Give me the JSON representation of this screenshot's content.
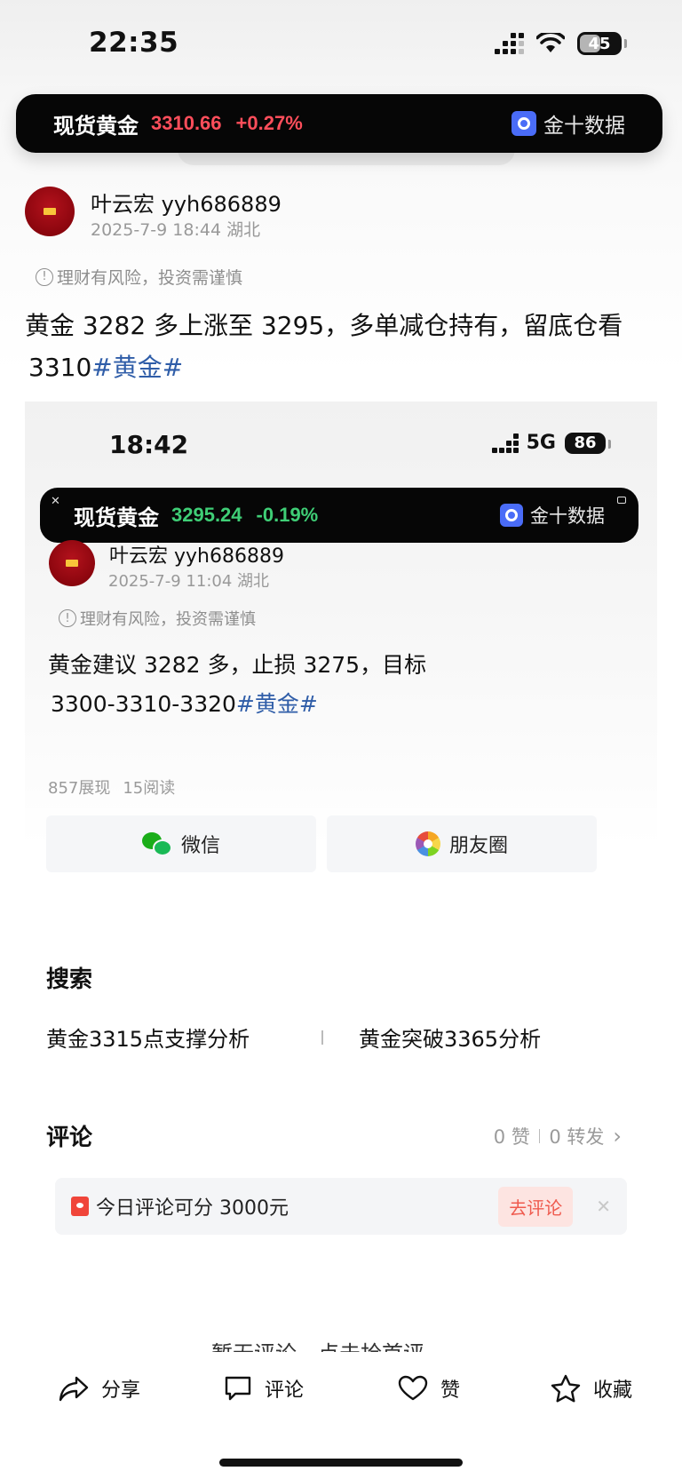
{
  "status_bar": {
    "time": "22:35",
    "battery": "45"
  },
  "ticker": {
    "name": "现货黄金",
    "price": "3310.66",
    "change": "+0.27%",
    "brand": "金十数据",
    "color": "#ff4e5b"
  },
  "post": {
    "author": "叶云宏 yyh686889",
    "meta": "2025-7-9 18:44   湖北",
    "risk_note": "理财有风险，投资需谨慎",
    "text_line1": "黄金 3282 多上涨至 3295，多单减仓持有，留底仓看",
    "text_line2": "3310",
    "hashtag": "#黄金#"
  },
  "embedded_screenshot": {
    "time": "18:42",
    "network": "5G",
    "battery": "86",
    "ticker": {
      "name": "现货黄金",
      "price": "3295.24",
      "change": "-0.19%",
      "brand": "金十数据",
      "color": "#3fce76"
    },
    "author": "叶云宏 yyh686889",
    "meta": "2025-7-9 11:04   湖北",
    "risk_note": "理财有风险，投资需谨慎",
    "text_line1": "黄金建议 3282 多，止损 3275，目标",
    "text_line2": "3300-3310-3320",
    "hashtag": "#黄金#",
    "views": "857展现",
    "reads": "15阅读",
    "share_wechat": "微信",
    "share_moments": "朋友圈",
    "search_title": "搜索",
    "search_items": [
      "黄金3315点支撑分析",
      "黄金突破3365分析"
    ],
    "comments_title": "评论",
    "likes": "0 赞",
    "reposts": "0 转发",
    "promo_text": "今日评论可分 3000元",
    "promo_button": "去评论",
    "cut_off_text": "暂无评论，点击抢首评"
  },
  "bottom_bar": {
    "share": "分享",
    "comment": "评论",
    "like": "赞",
    "favorite": "收藏"
  }
}
